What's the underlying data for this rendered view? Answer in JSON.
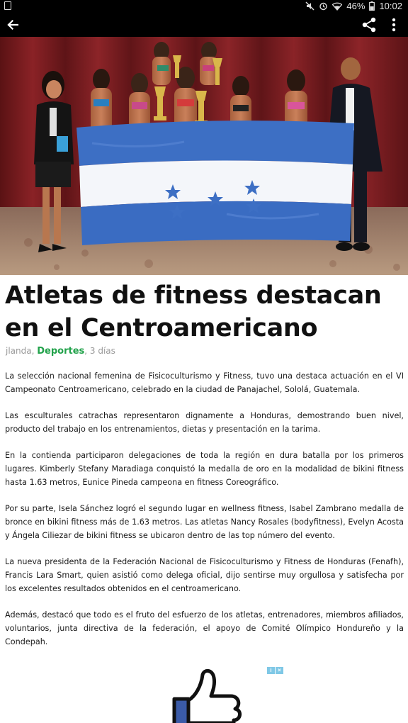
{
  "status_bar": {
    "battery": "46%",
    "time": "10:02",
    "icons": [
      "mute-icon",
      "alarm-icon",
      "wifi-icon",
      "battery-icon"
    ]
  },
  "app_bar": {
    "icons": [
      "back-arrow-icon",
      "share-icon",
      "more-vert-icon"
    ]
  },
  "article": {
    "title_line1": "Atletas de fitness destacan",
    "title_line2": "en el Centroamericano",
    "author": "jlanda",
    "author_sep": ", ",
    "category": "Deportes",
    "age": ", 3 días",
    "paragraphs": [
      "La selección nacional femenina de Fisicoculturismo y Fitness, tuvo una destaca actuación en el VI Campeonato Centroamericano, celebrado en la ciudad de Panajachel, Sololá, Guatemala.",
      "Las esculturales catrachas representaron dignamente a Honduras, demostrando buen nivel, producto del trabajo en los entrenamientos, dietas y presentación en la tarima.",
      "En la contienda participaron delegaciones de toda la región en dura batalla por los primeros lugares. Kimberly Stefany Maradiaga conquistó la medalla de oro en la modalidad de bikini fitness hasta 1.63 metros, Eunice Pineda campeona en fitness Coreográfico.",
      "Por su parte, Isela Sánchez logró el segundo lugar en wellness fitness, Isabel Zambrano medalla de bronce en bikini fitness más de 1.63 metros.  Las atletas Nancy Rosales (bodyfitness), Evelyn Acosta y Ángela Ciliezar  de bikini fitness se ubicaron dentro de las top número del evento.",
      "La nueva presidenta de la Federación Nacional de Fisicoculturismo y Fitness de Honduras (Fenafh), Francis Lara Smart, quien asistió como delega oficial, dijo sentirse muy orgullosa y satisfecha por los excelentes resultados obtenidos en el centroamericano.",
      "Además, destacó que todo es el fruto del esfuerzo de los atletas, entrenadores, miembros afiliados, voluntarios, junta directiva de la federación, el apoyo de Comité Olímpico Hondureño y la Condepah."
    ]
  },
  "ad": {
    "badge_icons": [
      "ad-info-icon",
      "ad-close-icon"
    ],
    "image": "thumbs-up-icon"
  },
  "colors": {
    "bars": "#000000",
    "category": "#22a24b",
    "byline": "#999999",
    "flag_blue": "#3d6fc4"
  }
}
